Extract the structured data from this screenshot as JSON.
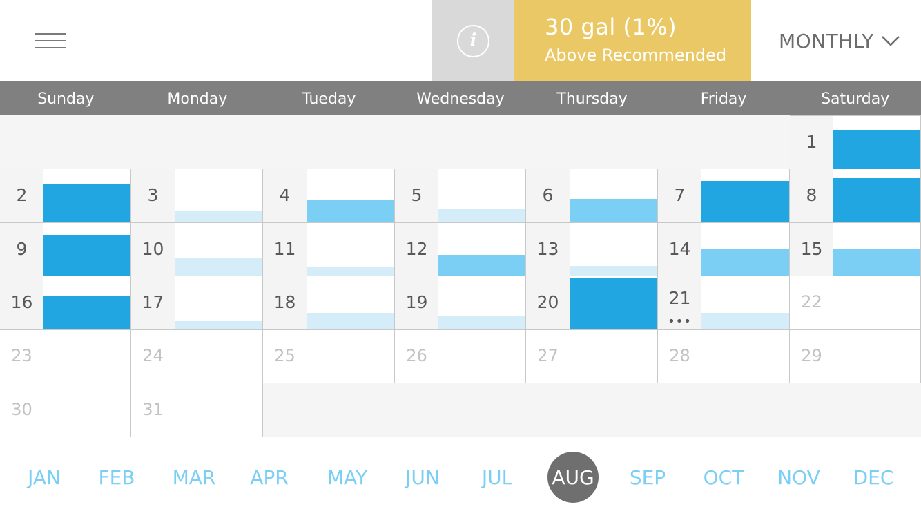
{
  "header": {
    "menu_icon": "hamburger-menu-icon",
    "info_icon": "info-icon",
    "status_value": "30 gal (1%)",
    "status_note": "Above Recommended",
    "period_label": "MONTHLY",
    "period_icon": "chevron-down-icon"
  },
  "colors": {
    "status_bg": "#ebc866",
    "bar_high": "#22a6e1",
    "bar_mid": "#7ccff4",
    "bar_low": "#d4edf9",
    "header_gray": "#808080"
  },
  "weekdays": [
    "Sunday",
    "Monday",
    "Tueday",
    "Wednesday",
    "Thursday",
    "Friday",
    "Saturday"
  ],
  "calendar": {
    "first_weekday_index": 6,
    "days_in_month": 31,
    "days_with_usage": 21,
    "current_day_marker": "•••",
    "usage": [
      {
        "day": 1,
        "level": "high",
        "fraction": 0.75
      },
      {
        "day": 2,
        "level": "high",
        "fraction": 0.74
      },
      {
        "day": 3,
        "level": "low",
        "fraction": 0.23
      },
      {
        "day": 4,
        "level": "mid",
        "fraction": 0.43
      },
      {
        "day": 5,
        "level": "low",
        "fraction": 0.26
      },
      {
        "day": 6,
        "level": "mid",
        "fraction": 0.45
      },
      {
        "day": 7,
        "level": "high",
        "fraction": 0.79
      },
      {
        "day": 8,
        "level": "high",
        "fraction": 0.86
      },
      {
        "day": 9,
        "level": "high",
        "fraction": 0.79
      },
      {
        "day": 10,
        "level": "low",
        "fraction": 0.35
      },
      {
        "day": 11,
        "level": "low",
        "fraction": 0.17
      },
      {
        "day": 12,
        "level": "mid",
        "fraction": 0.4
      },
      {
        "day": 13,
        "level": "low",
        "fraction": 0.19
      },
      {
        "day": 14,
        "level": "mid",
        "fraction": 0.52
      },
      {
        "day": 15,
        "level": "mid",
        "fraction": 0.52
      },
      {
        "day": 16,
        "level": "high",
        "fraction": 0.64
      },
      {
        "day": 17,
        "level": "low",
        "fraction": 0.16
      },
      {
        "day": 18,
        "level": "low",
        "fraction": 0.31
      },
      {
        "day": 19,
        "level": "low",
        "fraction": 0.26
      },
      {
        "day": 20,
        "level": "high",
        "fraction": 0.97
      },
      {
        "day": 21,
        "level": "low",
        "fraction": 0.32
      }
    ]
  },
  "months": [
    "JAN",
    "FEB",
    "MAR",
    "APR",
    "MAY",
    "JUN",
    "JUL",
    "AUG",
    "SEP",
    "OCT",
    "NOV",
    "DEC"
  ],
  "active_month_index": 7
}
